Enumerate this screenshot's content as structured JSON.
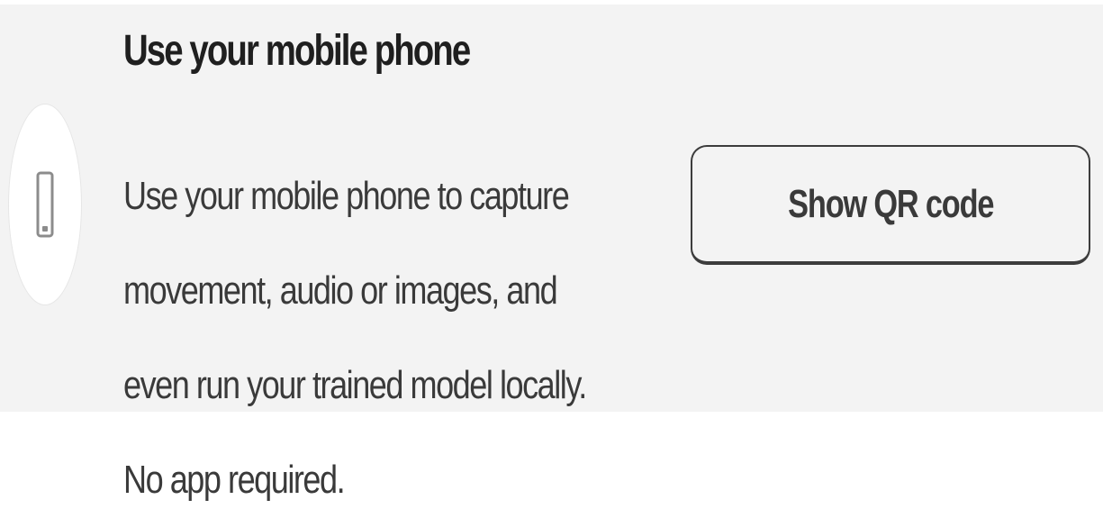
{
  "card": {
    "title": "Use your mobile phone",
    "icon": "mobile-phone-icon",
    "description": "Use your mobile phone to capture movement, audio or images, and even run your trained model locally. No app required.",
    "button_label": "Show QR code"
  },
  "colors": {
    "panel_background": "#f3f3f3",
    "title_text": "#1f1f1f",
    "body_text": "#3a3a3a",
    "button_border": "#3c3c3c",
    "icon_circle": "#ffffff"
  }
}
